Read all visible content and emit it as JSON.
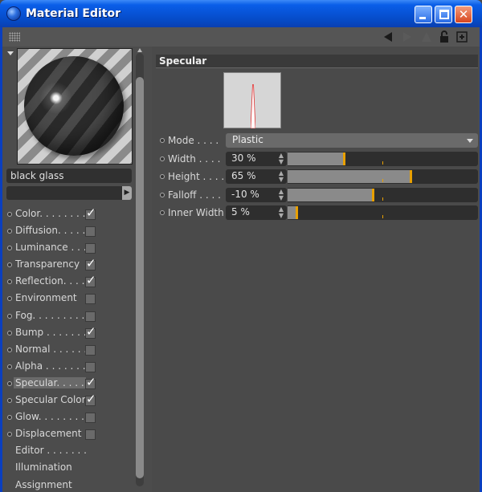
{
  "window": {
    "title": "Material Editor",
    "accent": "#0a5ee8"
  },
  "toolbar": {
    "icons": [
      "grip-icon",
      "back-arrow-icon",
      "forward-arrow-icon",
      "up-arrow-icon",
      "lock-icon",
      "new-window-icon"
    ]
  },
  "material": {
    "name": "black glass"
  },
  "channels": [
    {
      "label": "Color. . . . . . . .",
      "checked": true,
      "has_box": true,
      "active": false
    },
    {
      "label": "Diffusion. . . . .",
      "checked": false,
      "has_box": true,
      "active": false
    },
    {
      "label": "Luminance . . .",
      "checked": false,
      "has_box": true,
      "active": false
    },
    {
      "label": "Transparency",
      "checked": true,
      "has_box": true,
      "active": false
    },
    {
      "label": "Reflection. . . .",
      "checked": true,
      "has_box": true,
      "active": false
    },
    {
      "label": "Environment",
      "checked": false,
      "has_box": true,
      "active": false
    },
    {
      "label": "Fog. . . . . . . . .",
      "checked": false,
      "has_box": true,
      "active": false
    },
    {
      "label": "Bump . . . . . . .",
      "checked": true,
      "has_box": true,
      "active": false
    },
    {
      "label": "Normal . . . . . .",
      "checked": false,
      "has_box": true,
      "active": false
    },
    {
      "label": "Alpha . . . . . . .",
      "checked": false,
      "has_box": true,
      "active": false
    },
    {
      "label": "Specular. . . . .",
      "checked": true,
      "has_box": true,
      "active": true
    },
    {
      "label": "Specular Color",
      "checked": true,
      "has_box": true,
      "active": false
    },
    {
      "label": "Glow. . . . . . . .",
      "checked": false,
      "has_box": true,
      "active": false
    },
    {
      "label": "Displacement",
      "checked": false,
      "has_box": true,
      "active": false
    },
    {
      "label": "Editor . . . . . . .",
      "checked": false,
      "has_box": false,
      "active": false
    },
    {
      "label": "Illumination",
      "checked": false,
      "has_box": false,
      "active": false
    },
    {
      "label": "Assignment",
      "checked": false,
      "has_box": false,
      "active": false
    }
  ],
  "specular": {
    "section_title": "Specular",
    "mode": {
      "label": "Mode . . . .",
      "value": "Plastic"
    },
    "params": [
      {
        "label": "Width . . . .",
        "value": "30 %",
        "fraction": 0.3
      },
      {
        "label": "Height . . . .",
        "value": "65 %",
        "fraction": 0.65
      },
      {
        "label": "Falloff . . . .",
        "value": "-10 %",
        "fraction": 0.45
      },
      {
        "label": "Inner Width",
        "value": "5 %",
        "fraction": 0.05
      }
    ]
  }
}
